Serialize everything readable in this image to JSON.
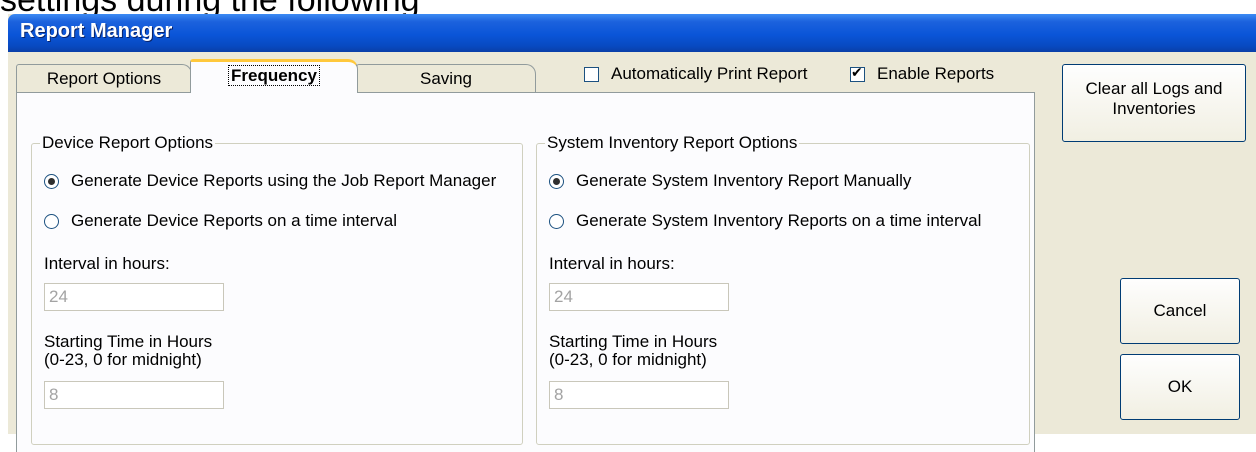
{
  "caption": "settings during the following",
  "window": {
    "title": "Report Manager"
  },
  "tabs": [
    {
      "label": "Report Options"
    },
    {
      "label": "Frequency"
    },
    {
      "label": "Saving"
    }
  ],
  "toolbar": {
    "auto_print": {
      "label": "Automatically Print Report",
      "checked": false
    },
    "enable_reports": {
      "label": "Enable Reports",
      "checked": true
    }
  },
  "device_group": {
    "legend": "Device Report Options",
    "radio_job": "Generate Device Reports using the Job Report Manager",
    "radio_interval": "Generate Device Reports on a time interval",
    "interval_label": "Interval in hours:",
    "interval_value": "24",
    "start_label_1": "Starting Time in Hours",
    "start_label_2": "(0-23, 0 for midnight)",
    "start_value": "8"
  },
  "inventory_group": {
    "legend": "System Inventory Report Options",
    "radio_manual": "Generate System Inventory Report Manually",
    "radio_interval": "Generate System Inventory Reports on a time interval",
    "interval_label": "Interval in hours:",
    "interval_value": "24",
    "start_label_1": "Starting Time in Hours",
    "start_label_2": "(0-23, 0 for midnight)",
    "start_value": "8"
  },
  "buttons": {
    "clear_line1": "Clear all Logs and",
    "clear_line2": "Inventories",
    "cancel": "Cancel",
    "ok": "OK"
  }
}
